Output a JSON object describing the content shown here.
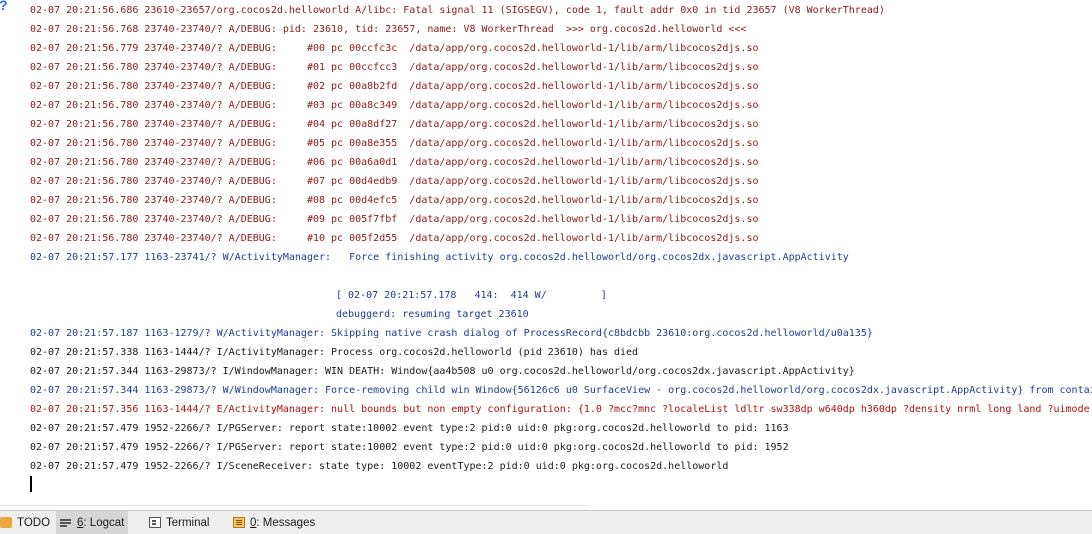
{
  "gutter": {
    "mark": "?"
  },
  "log_lines": [
    {
      "level": "A",
      "text": "02-07 20:21:56.686 23610-23657/org.cocos2d.helloworld A/libc: Fatal signal 11 (SIGSEGV), code 1, fault addr 0x0 in tid 23657 (V8 WorkerThread)"
    },
    {
      "level": "A",
      "text": "02-07 20:21:56.768 23740-23740/? A/DEBUG: pid: 23610, tid: 23657, name: V8 WorkerThread  >>> org.cocos2d.helloworld <<<"
    },
    {
      "level": "A",
      "text": "02-07 20:21:56.779 23740-23740/? A/DEBUG:     #00 pc 00ccfc3c  /data/app/org.cocos2d.helloworld-1/lib/arm/libcocos2djs.so"
    },
    {
      "level": "A",
      "text": "02-07 20:21:56.780 23740-23740/? A/DEBUG:     #01 pc 00ccfcc3  /data/app/org.cocos2d.helloworld-1/lib/arm/libcocos2djs.so"
    },
    {
      "level": "A",
      "text": "02-07 20:21:56.780 23740-23740/? A/DEBUG:     #02 pc 00a8b2fd  /data/app/org.cocos2d.helloworld-1/lib/arm/libcocos2djs.so"
    },
    {
      "level": "A",
      "text": "02-07 20:21:56.780 23740-23740/? A/DEBUG:     #03 pc 00a8c349  /data/app/org.cocos2d.helloworld-1/lib/arm/libcocos2djs.so"
    },
    {
      "level": "A",
      "text": "02-07 20:21:56.780 23740-23740/? A/DEBUG:     #04 pc 00a8df27  /data/app/org.cocos2d.helloworld-1/lib/arm/libcocos2djs.so"
    },
    {
      "level": "A",
      "text": "02-07 20:21:56.780 23740-23740/? A/DEBUG:     #05 pc 00a8e355  /data/app/org.cocos2d.helloworld-1/lib/arm/libcocos2djs.so"
    },
    {
      "level": "A",
      "text": "02-07 20:21:56.780 23740-23740/? A/DEBUG:     #06 pc 00a6a0d1  /data/app/org.cocos2d.helloworld-1/lib/arm/libcocos2djs.so"
    },
    {
      "level": "A",
      "text": "02-07 20:21:56.780 23740-23740/? A/DEBUG:     #07 pc 00d4edb9  /data/app/org.cocos2d.helloworld-1/lib/arm/libcocos2djs.so"
    },
    {
      "level": "A",
      "text": "02-07 20:21:56.780 23740-23740/? A/DEBUG:     #08 pc 00d4efc5  /data/app/org.cocos2d.helloworld-1/lib/arm/libcocos2djs.so"
    },
    {
      "level": "A",
      "text": "02-07 20:21:56.780 23740-23740/? A/DEBUG:     #09 pc 005f7fbf  /data/app/org.cocos2d.helloworld-1/lib/arm/libcocos2djs.so"
    },
    {
      "level": "A",
      "text": "02-07 20:21:56.780 23740-23740/? A/DEBUG:     #10 pc 005f2d55  /data/app/org.cocos2d.helloworld-1/lib/arm/libcocos2djs.so"
    },
    {
      "level": "W",
      "text": "02-07 20:21:57.177 1163-23741/? W/ActivityManager:   Force finishing activity org.cocos2d.helloworld/org.cocos2dx.javascript.AppActivity"
    },
    {
      "level": "D",
      "text": "[ 02-07 20:21:57.178   414:  414 W/         ]"
    },
    {
      "level": "D",
      "text": "debuggerd: resuming target 23610"
    },
    {
      "level": "W",
      "text": "02-07 20:21:57.187 1163-1279/? W/ActivityManager: Skipping native crash dialog of ProcessRecord{c8bdcbb 23610:org.cocos2d.helloworld/u0a135}"
    },
    {
      "level": "I",
      "text": "02-07 20:21:57.338 1163-1444/? I/ActivityManager: Process org.cocos2d.helloworld (pid 23610) has died"
    },
    {
      "level": "I",
      "text": "02-07 20:21:57.344 1163-29873/? I/WindowManager: WIN DEATH: Window{aa4b508 u0 org.cocos2d.helloworld/org.cocos2dx.javascript.AppActivity}"
    },
    {
      "level": "W",
      "text": "02-07 20:21:57.344 1163-29873/? W/WindowManager: Force-removing child win Window{56126c6 u0 SurfaceView - org.cocos2d.helloworld/org.cocos2dx.javascript.AppActivity} from contai"
    },
    {
      "level": "E",
      "text": "02-07 20:21:57.356 1163-1444/? E/ActivityManager: null bounds but non empty configuration: {1.0 ?mcc?mnc ?localeList ldltr sw338dp w640dp h360dp ?density nrml long land ?uimode ?"
    },
    {
      "level": "I",
      "text": "02-07 20:21:57.479 1952-2266/? I/PGServer: report state:10002 event type:2 pid:0 uid:0 pkg:org.cocos2d.helloworld to pid: 1163"
    },
    {
      "level": "I",
      "text": "02-07 20:21:57.479 1952-2266/? I/PGServer: report state:10002 event type:2 pid:0 uid:0 pkg:org.cocos2d.helloworld to pid: 1952"
    },
    {
      "level": "I",
      "text": "02-07 20:21:57.479 1952-2266/? I/SceneReceiver: state type: 10002 eventType:2 pid:0 uid:0 pkg:org.cocos2d.helloworld"
    }
  ],
  "toolbar": {
    "todo": {
      "label": "TODO",
      "icon": "todo-icon"
    },
    "logcat": {
      "mnemonic": "6",
      "label": ": Logcat",
      "icon": "logcat-icon"
    },
    "terminal": {
      "label": "Terminal",
      "icon": "terminal-icon"
    },
    "messages": {
      "mnemonic": "0",
      "label": ": Messages",
      "icon": "messages-icon"
    }
  }
}
